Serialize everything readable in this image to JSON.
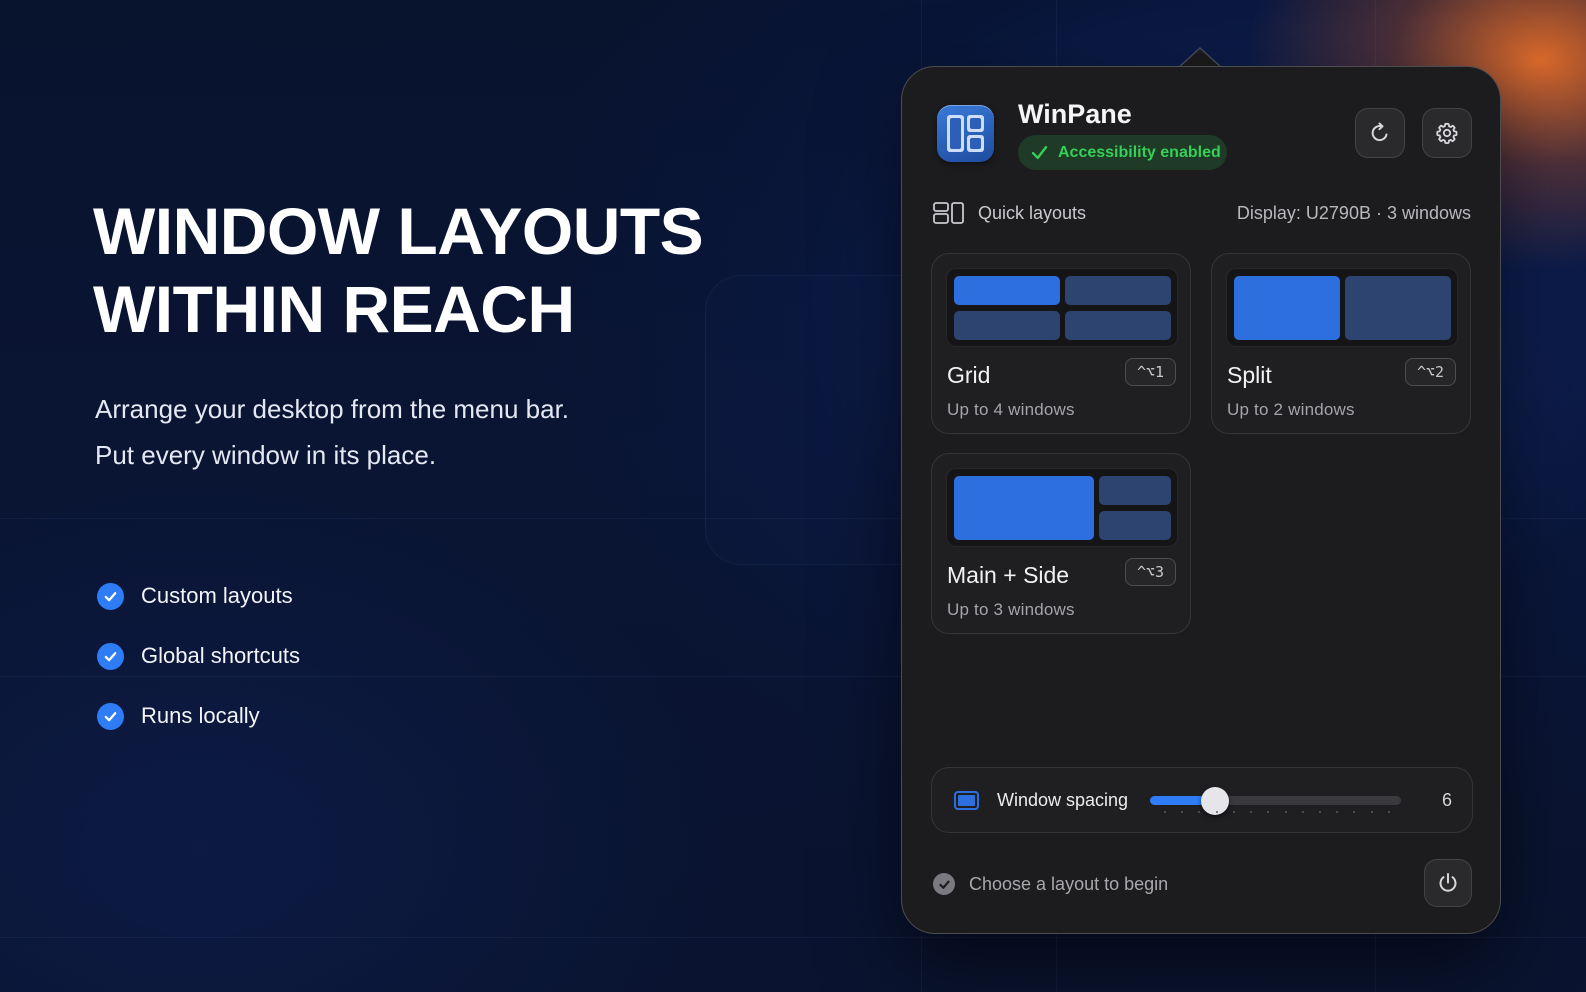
{
  "hero": {
    "title_line1": "WINDOW LAYOUTS",
    "title_line2": "WITHIN REACH",
    "subtitle_line1": "Arrange your desktop from the menu bar.",
    "subtitle_line2": "Put every window in its place."
  },
  "features": [
    {
      "label": "Custom layouts"
    },
    {
      "label": "Global shortcuts"
    },
    {
      "label": "Runs locally"
    }
  ],
  "app": {
    "name": "WinPane",
    "status": "Accessibility enabled"
  },
  "quick_layouts": {
    "heading": "Quick layouts",
    "display_info": "Display: U2790B · 3 windows",
    "cards": [
      {
        "title": "Grid",
        "subtitle": "Up to 4 windows",
        "shortcut": "^⌥1"
      },
      {
        "title": "Split",
        "subtitle": "Up to 2 windows",
        "shortcut": "^⌥2"
      },
      {
        "title": "Main + Side",
        "subtitle": "Up to 3 windows",
        "shortcut": "^⌥3"
      }
    ]
  },
  "spacing": {
    "label": "Window spacing",
    "value": "6",
    "slider_fraction": 0.26
  },
  "footer": {
    "status": "Choose a layout to begin"
  },
  "colors": {
    "accent": "#2e7cf6",
    "success": "#34d058",
    "panel_bg": "#1c1c1e"
  },
  "icons": {
    "refresh": "refresh-icon",
    "settings": "gear-icon",
    "power": "power-icon",
    "quick_layouts": "layout-icon",
    "check": "check-icon"
  }
}
